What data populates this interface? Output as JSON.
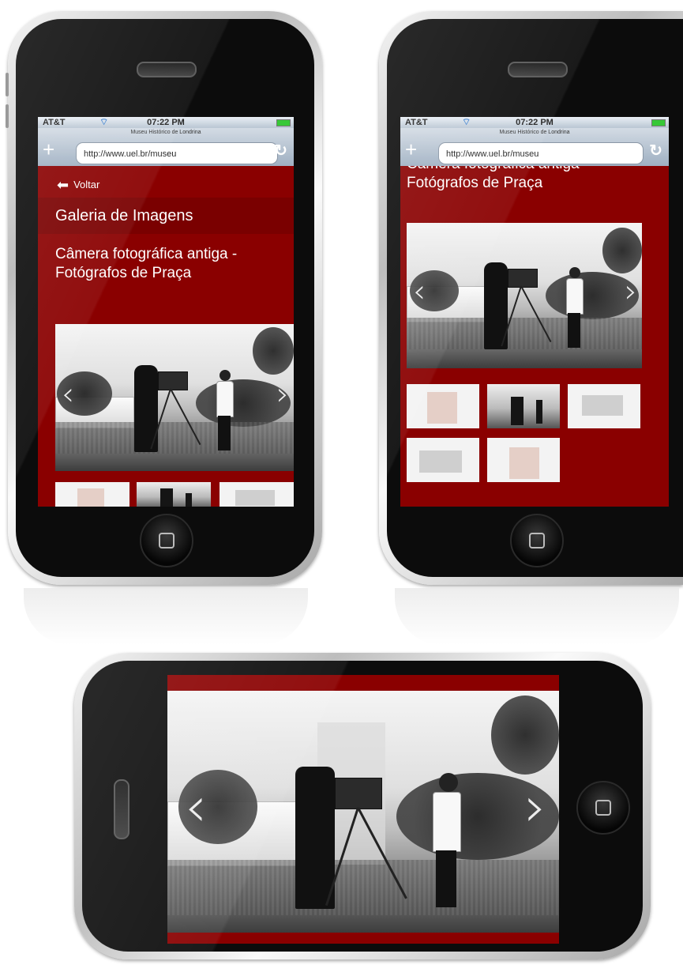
{
  "browser": {
    "carrier": "AT&T",
    "time": "07:22 PM",
    "page_title": "Museu Histórico de Londrina",
    "url": "http://www.uel.br/museu"
  },
  "page": {
    "back_label": "Voltar",
    "gallery_heading": "Galeria de Imagens",
    "caption_line1": "Câmera fotográfica antiga -",
    "caption_line2": "Fotógrafos de Praça"
  },
  "icons": {
    "add": "plus-icon",
    "reload": "reload-icon",
    "back": "back-arrow-icon",
    "prev": "chevron-left-icon",
    "next": "chevron-right-icon",
    "wifi": "wifi-icon",
    "battery": "battery-icon",
    "home": "home-button-icon"
  },
  "glyphs": {
    "plus": "+",
    "reload": "↻",
    "back_arrow": "⬅",
    "prev": "‹",
    "next": "›",
    "wifi": "⌔"
  },
  "colors": {
    "page_bg": "#8a0000",
    "header_bg": "#7a0000",
    "url_bar": "#9fb0c2"
  }
}
